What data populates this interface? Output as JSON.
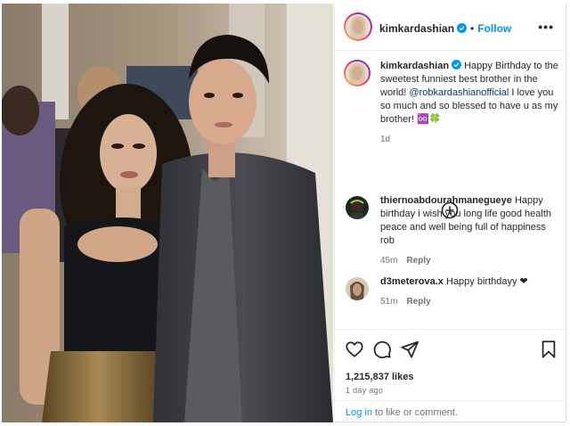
{
  "post": {
    "photo_alt": "photo",
    "author": {
      "username": "kimkardashian",
      "verified": true,
      "follow_label": "Follow",
      "separator": "•",
      "more_label": "•••"
    },
    "caption": {
      "username": "kimkardashian",
      "text_before": "Happy Birthday to the sweetest funniest best brother in the world!",
      "mention": "@robkardashianofficial",
      "text_after": "I love you so much and so blessed to have u as my brother! ♾️🍀",
      "age": "1d"
    },
    "comments": [
      {
        "username": "thiernoabdourahmanegueye",
        "text": "Happy birthday i wish you long life good health peace and well being full of happiness rob",
        "age": "45m",
        "reply_label": "Reply"
      },
      {
        "username": "d3meterova.x",
        "text": "Happy birthdayy ❤",
        "age": "51m",
        "reply_label": "Reply"
      }
    ],
    "likes": "1,215,837 likes",
    "time_ago": "1 day ago",
    "login": {
      "link_label": "Log in",
      "text": "to like or comment."
    },
    "colors": {
      "link_blue": "#0095f6",
      "mention_blue": "#00376b",
      "muted": "#737373",
      "text": "#262626"
    },
    "icons": [
      "heart-icon",
      "comment-icon",
      "share-icon",
      "bookmark-icon",
      "plus-circle-icon",
      "verified-badge-icon"
    ]
  }
}
